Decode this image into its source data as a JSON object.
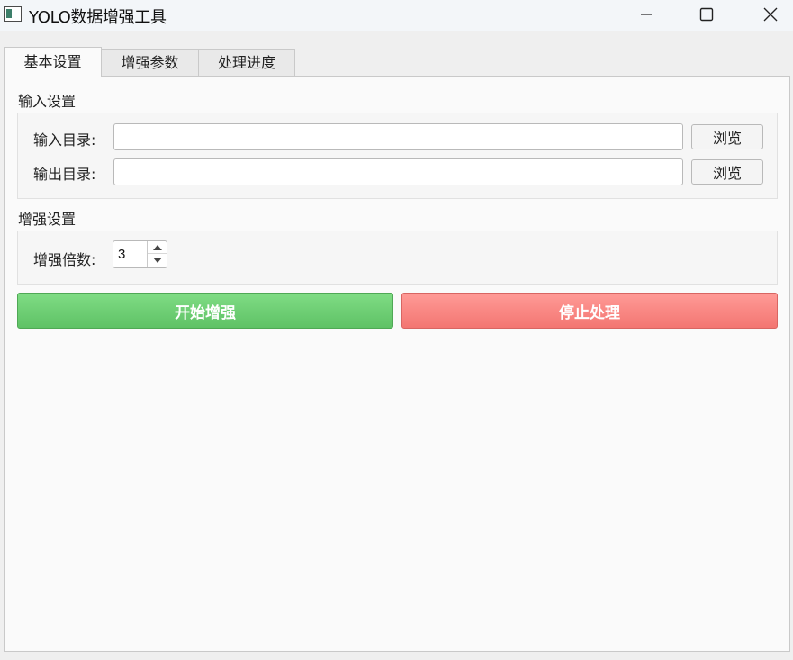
{
  "window": {
    "title": "YOLO数据增强工具"
  },
  "tabs": [
    {
      "label": "基本设置",
      "active": true
    },
    {
      "label": "增强参数",
      "active": false
    },
    {
      "label": "处理进度",
      "active": false
    }
  ],
  "input_settings": {
    "section_label": "输入设置",
    "input_dir_label": "输入目录:",
    "input_dir_value": "",
    "output_dir_label": "输出目录:",
    "output_dir_value": "",
    "browse_label": "浏览"
  },
  "augment_settings": {
    "section_label": "增强设置",
    "multiplier_label": "增强倍数:",
    "multiplier_value": "3"
  },
  "actions": {
    "start_label": "开始增强",
    "stop_label": "停止处理"
  },
  "colors": {
    "start_button": "#6ccf72",
    "stop_button": "#fa8581",
    "panel_background": "#fafafa"
  },
  "icons": {
    "app": "app-window-icon",
    "minimize": "minimize-icon",
    "maximize": "maximize-icon",
    "close": "close-icon",
    "spin_up": "chevron-up-icon",
    "spin_down": "chevron-down-icon"
  }
}
